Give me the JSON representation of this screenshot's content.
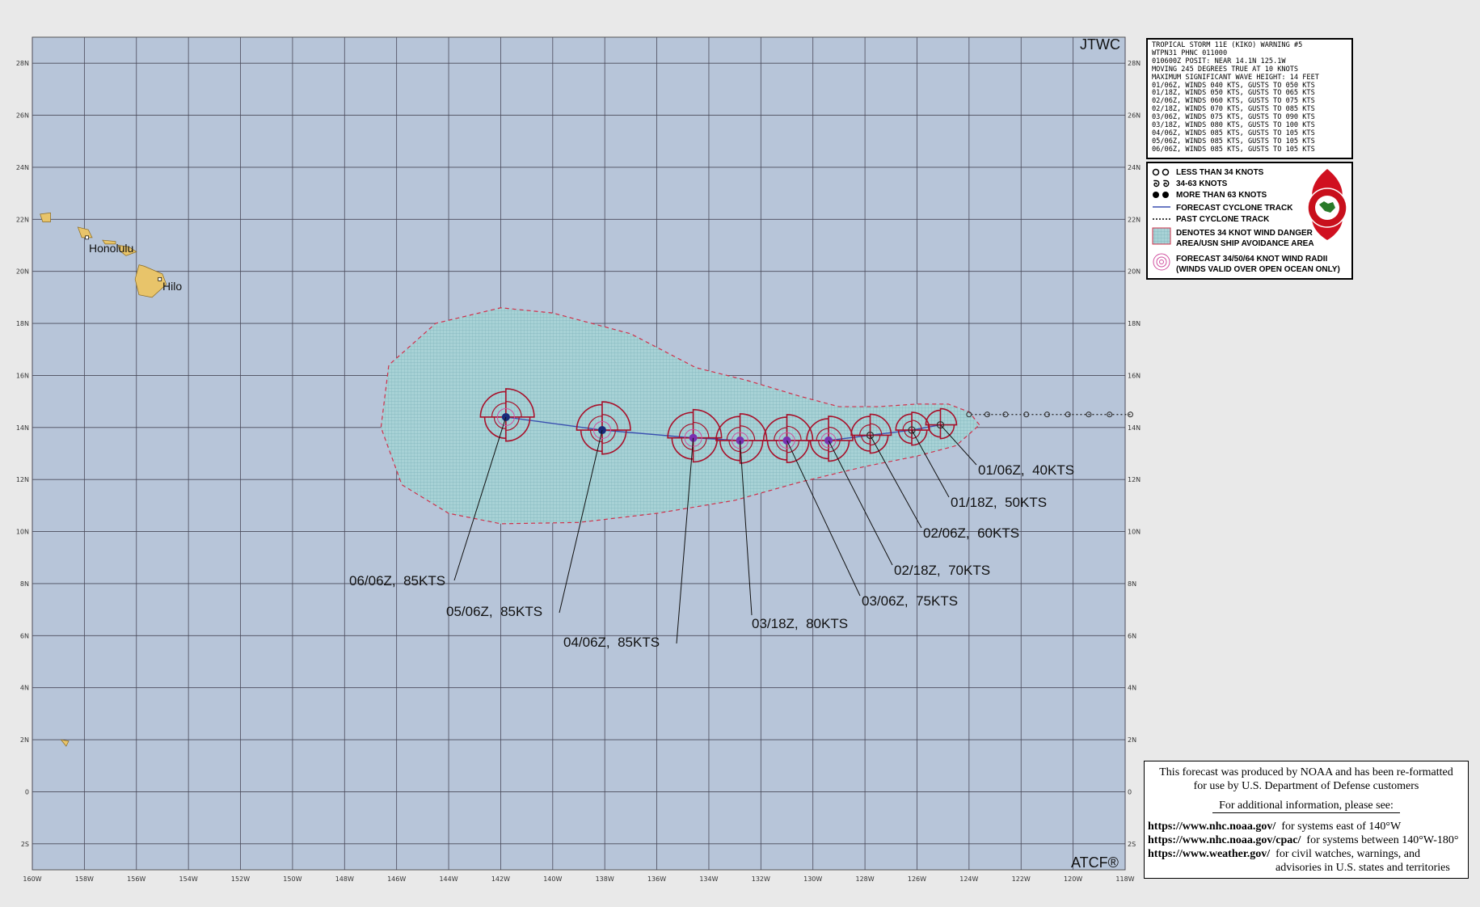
{
  "map": {
    "agency": "JTWC",
    "footer_mark": "ATCF®",
    "lon_labels": [
      "160W",
      "158W",
      "156W",
      "154W",
      "152W",
      "150W",
      "148W",
      "146W",
      "144W",
      "142W",
      "140W",
      "138W",
      "136W",
      "134W",
      "132W",
      "130W",
      "128W",
      "126W",
      "124W",
      "122W",
      "120W",
      "118W"
    ],
    "lat_labels": [
      "28N",
      "26N",
      "24N",
      "22N",
      "20N",
      "18N",
      "16N",
      "14N",
      "12N",
      "10N",
      "8N",
      "6N",
      "4N",
      "2N",
      "0",
      "2S"
    ],
    "places": [
      "Honolulu",
      "Hilo"
    ],
    "colors": {
      "ocean": "#b7c5d9",
      "grid": "#4a4a5a",
      "land": "#e8c46a",
      "danger_fill": "#9ccfd4",
      "radii": "#a8102a",
      "track": "#3a4fb0"
    },
    "forecast_labels": [
      {
        "text": "01/06Z,  40KTS",
        "lon": -125.1,
        "lat": 14.1
      },
      {
        "text": "01/18Z,  50KTS",
        "lon": -126.2,
        "lat": 13.9
      },
      {
        "text": "02/06Z,  60KTS",
        "lon": -127.8,
        "lat": 13.7
      },
      {
        "text": "02/18Z,  70KTS",
        "lon": -129.4,
        "lat": 13.5
      },
      {
        "text": "03/06Z,  75KTS",
        "lon": -131.0,
        "lat": 13.5
      },
      {
        "text": "03/18Z,  80KTS",
        "lon": -132.8,
        "lat": 13.5
      },
      {
        "text": "04/06Z,  85KTS",
        "lon": -134.6,
        "lat": 13.6
      },
      {
        "text": "05/06Z,  85KTS",
        "lon": -138.1,
        "lat": 13.9
      },
      {
        "text": "06/06Z,  85KTS",
        "lon": -141.8,
        "lat": 14.4
      }
    ],
    "past_track": [
      {
        "lon": -117.8,
        "lat": 14.5
      },
      {
        "lon": -118.6,
        "lat": 14.5
      },
      {
        "lon": -119.4,
        "lat": 14.5
      },
      {
        "lon": -120.2,
        "lat": 14.5
      },
      {
        "lon": -121.0,
        "lat": 14.5
      },
      {
        "lon": -121.8,
        "lat": 14.5
      },
      {
        "lon": -122.6,
        "lat": 14.5
      },
      {
        "lon": -123.3,
        "lat": 14.5
      },
      {
        "lon": -124.0,
        "lat": 14.5
      }
    ]
  },
  "warning": {
    "lines": [
      "TROPICAL STORM 11E (KIKO) WARNING #5",
      "WTPN31 PHNC 011000",
      "010600Z POSIT: NEAR 14.1N 125.1W",
      "MOVING 245 DEGREES TRUE AT 10 KNOTS",
      "MAXIMUM SIGNIFICANT WAVE HEIGHT: 14 FEET",
      "01/06Z, WINDS 040 KTS, GUSTS TO 050 KTS",
      "01/18Z, WINDS 050 KTS, GUSTS TO 065 KTS",
      "02/06Z, WINDS 060 KTS, GUSTS TO 075 KTS",
      "02/18Z, WINDS 070 KTS, GUSTS TO 085 KTS",
      "03/06Z, WINDS 075 KTS, GUSTS TO 090 KTS",
      "03/18Z, WINDS 080 KTS, GUSTS TO 100 KTS",
      "04/06Z, WINDS 085 KTS, GUSTS TO 105 KTS",
      "05/06Z, WINDS 085 KTS, GUSTS TO 105 KTS",
      "06/06Z, WINDS 085 KTS, GUSTS TO 105 KTS"
    ]
  },
  "legend": {
    "items": [
      "LESS THAN 34 KNOTS",
      "34-63 KNOTS",
      "MORE THAN 63 KNOTS",
      "FORECAST CYCLONE TRACK",
      "PAST CYCLONE TRACK",
      "DENOTES 34 KNOT WIND DANGER",
      "AREA/USN SHIP AVOIDANCE AREA",
      "FORECAST 34/50/64 KNOT WIND RADII",
      "(WINDS VALID OVER OPEN OCEAN ONLY)"
    ]
  },
  "noaa": {
    "line1": "This forecast was produced by NOAA and has been re-formatted",
    "line2": "for use by U.S. Department of Defense customers",
    "line3": "For additional information, please see:",
    "links": [
      {
        "url": "https://www.nhc.noaa.gov/",
        "desc": "for systems east of 140°W"
      },
      {
        "url": "https://www.nhc.noaa.gov/cpac/",
        "desc": "for systems between 140°W-180°"
      },
      {
        "url": "https://www.weather.gov/",
        "desc": "for civil watches, warnings, and"
      }
    ],
    "line_last": "advisories in U.S. states and territories"
  }
}
